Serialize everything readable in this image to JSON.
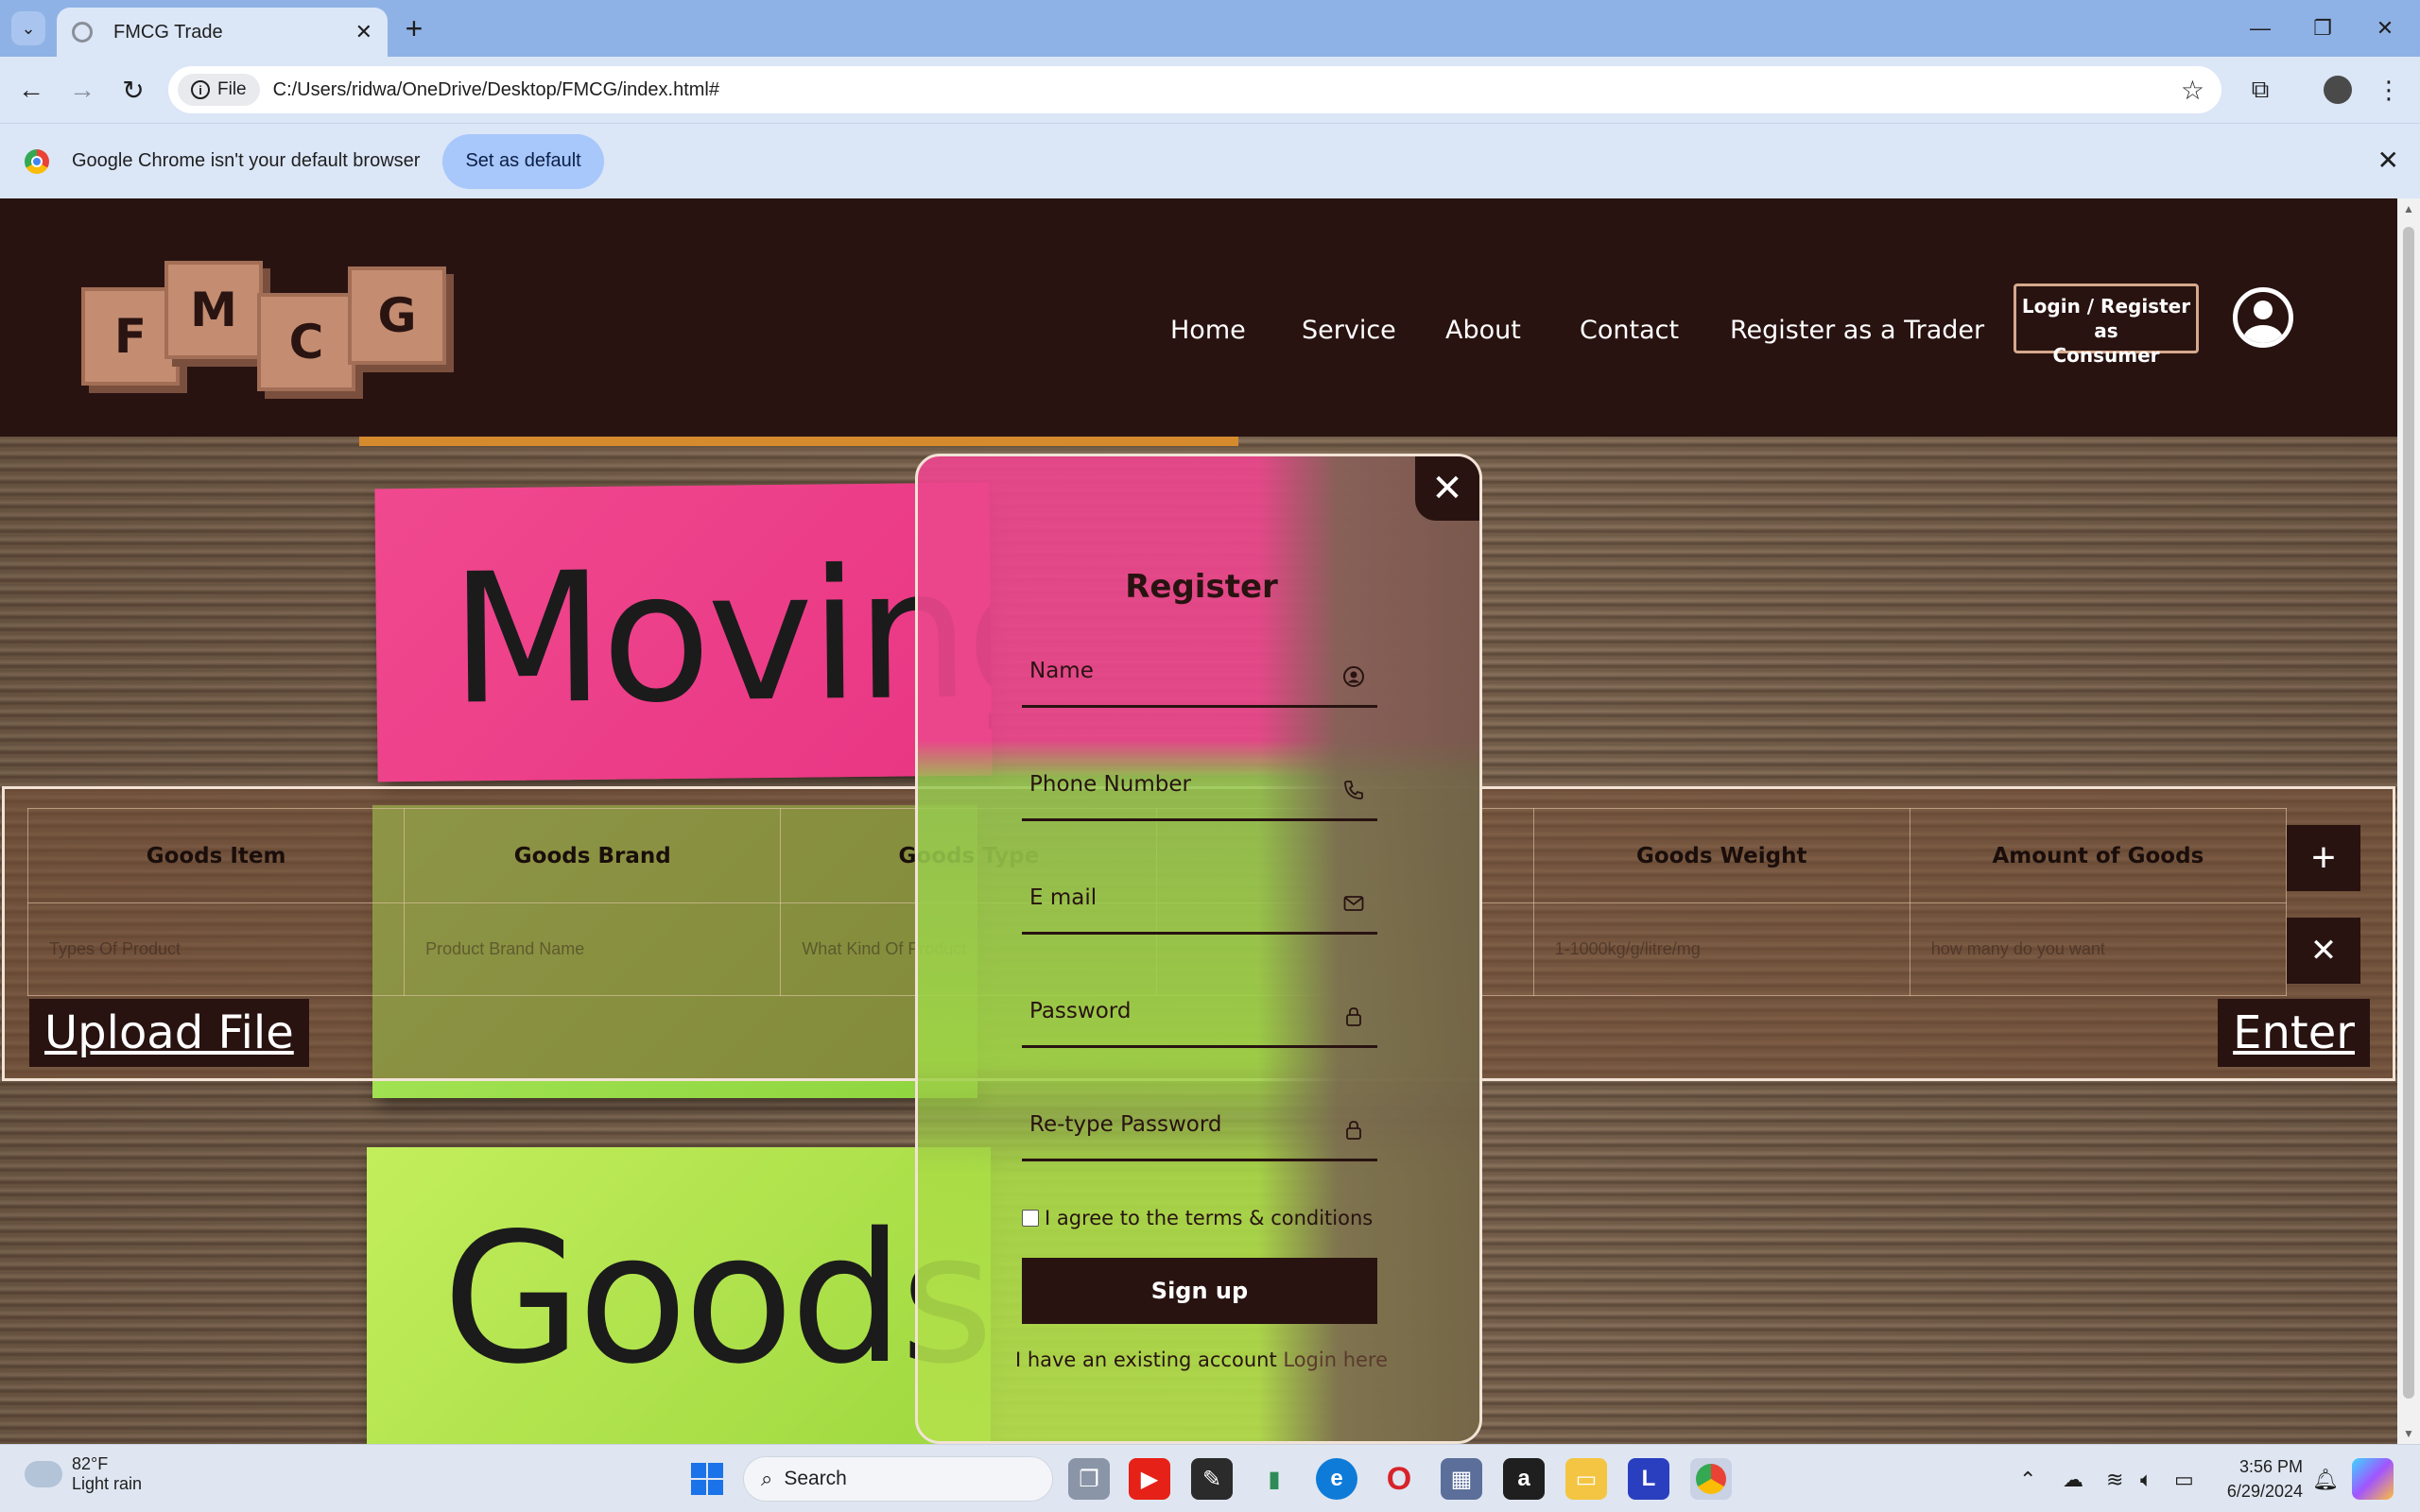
{
  "browser": {
    "tab_title": "FMCG Trade",
    "url_chip": "File",
    "url": "C:/Users/ridwa/OneDrive/Desktop/FMCG/index.html#",
    "infobar_text": "Google Chrome isn't your default browser",
    "infobar_button": "Set as default"
  },
  "site": {
    "logo_letters": [
      "F",
      "M",
      "C",
      "G"
    ],
    "nav": [
      "Home",
      "Service",
      "About",
      "Contact",
      "Register as a Trader"
    ],
    "login_button_line1": "Login / Register as",
    "login_button_line2": "Consumer",
    "hero_words": {
      "top": "Moving",
      "bottom": "Goods"
    }
  },
  "goods_form": {
    "headers": [
      "Goods Item",
      "Goods Brand",
      "Goods Type",
      "",
      "Goods Weight",
      "Amount of Goods"
    ],
    "placeholders": [
      "Types Of Product",
      "Product Brand Name",
      "What Kind Of Product",
      "",
      "1-1000kg/g/litre/mg",
      "how many do you want"
    ],
    "upload_label": "Upload File",
    "enter_label": "Enter",
    "add_symbol": "+",
    "remove_symbol": "✕"
  },
  "register_modal": {
    "title": "Register",
    "fields": [
      {
        "label": "Name",
        "icon": "user-circle-icon"
      },
      {
        "label": "Phone Number",
        "icon": "phone-icon"
      },
      {
        "label": "E mail",
        "icon": "mail-icon"
      },
      {
        "label": "Password",
        "icon": "lock-icon"
      },
      {
        "label": "Re-type Password",
        "icon": "lock-icon"
      }
    ],
    "terms": "I agree to the terms & conditions",
    "submit": "Sign up",
    "existing_text": "I have an existing account",
    "existing_link": "Login here"
  },
  "taskbar": {
    "temperature": "82°F",
    "weather": "Light rain",
    "search": "Search",
    "time": "3:56 PM",
    "date": "6/29/2024"
  },
  "colors": {
    "site_dark": "#281311",
    "accent_border": "#d6a88c",
    "chrome_blue": "#8fb2e6"
  }
}
